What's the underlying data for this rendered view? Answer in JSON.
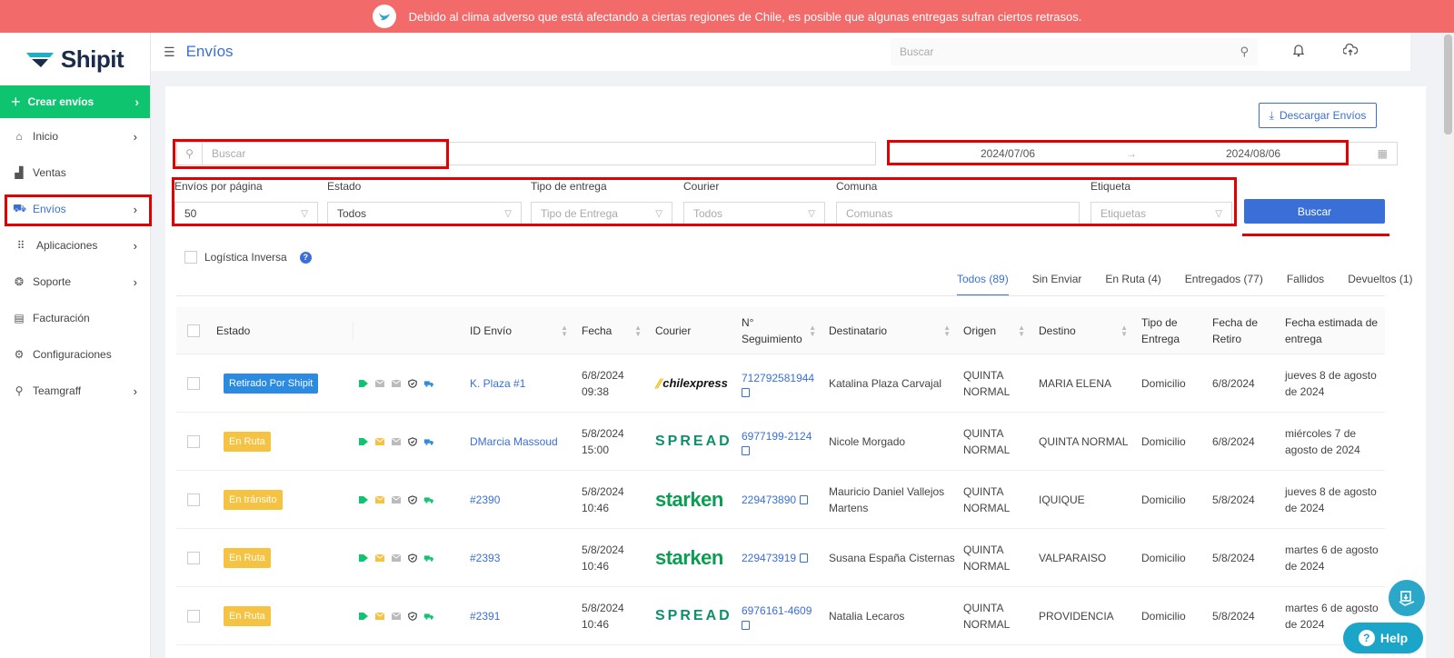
{
  "banner": {
    "text": "Debido al clima adverso que está afectando a ciertas regiones de Chile, es posible que algunas entregas sufran ciertos retrasos."
  },
  "sidebar": {
    "logo": "Shipit",
    "create_label": "Crear envíos",
    "items": [
      {
        "label": "Inicio",
        "icon": "home-icon",
        "chevron": true
      },
      {
        "label": "Ventas",
        "icon": "sales-icon",
        "chevron": false
      },
      {
        "label": "Envíos",
        "icon": "truck-icon",
        "chevron": true,
        "active": true
      },
      {
        "label": "Aplicaciones",
        "icon": "grid-icon",
        "chevron": true
      },
      {
        "label": "Soporte",
        "icon": "support-icon",
        "chevron": true
      },
      {
        "label": "Facturación",
        "icon": "invoice-icon",
        "chevron": false
      },
      {
        "label": "Configuraciones",
        "icon": "gear-icon",
        "chevron": false
      },
      {
        "label": "Teamgraff",
        "icon": "user-icon",
        "chevron": true
      }
    ]
  },
  "header": {
    "title": "Envíos",
    "search_placeholder": "Buscar"
  },
  "toolbar": {
    "download_label": "Descargar Envíos",
    "search_placeholder": "Buscar",
    "date_from": "2024/07/06",
    "date_to": "2024/08/06",
    "date_arrow": "→"
  },
  "filters": {
    "per_page": {
      "label": "Envíos por página",
      "value": "50"
    },
    "estado": {
      "label": "Estado",
      "value": "Todos"
    },
    "tipo_entrega": {
      "label": "Tipo de entrega",
      "placeholder": "Tipo de Entrega"
    },
    "courier": {
      "label": "Courier",
      "placeholder": "Todos"
    },
    "comuna": {
      "label": "Comuna",
      "placeholder": "Comunas"
    },
    "etiqueta": {
      "label": "Etiqueta",
      "placeholder": "Etiquetas"
    },
    "search_button": "Buscar"
  },
  "logistica_label": "Logística Inversa",
  "tabs": [
    "Todos (89)",
    "Sin Enviar",
    "En Ruta (4)",
    "Entregados (77)",
    "Fallidos",
    "Devueltos (1)"
  ],
  "table": {
    "headers": {
      "estado": "Estado",
      "id": "ID Envío",
      "fecha": "Fecha",
      "courier": "Courier",
      "seguimiento": "N° Seguimiento",
      "destinatario": "Destinatario",
      "origen": "Origen",
      "destino": "Destino",
      "tipo": "Tipo de Entrega",
      "retiro": "Fecha de Retiro",
      "estimada": "Fecha estimada de entrega"
    },
    "rows": [
      {
        "estado": "Retirado Por Shipit",
        "estado_color": "#2a8be0",
        "id": "K. Plaza #1",
        "fecha": "6/8/2024 09:38",
        "courier": "chilexpress",
        "tracking": "712792581944",
        "copy_inline": false,
        "destinatario": "Katalina Plaza Carvajal",
        "origen": "QUINTA NORMAL",
        "destino": "MARIA ELENA",
        "tipo": "Domicilio",
        "retiro": "6/8/2024",
        "estimada": "jueves 8 de agosto de 2024",
        "mail_color": "#bbb",
        "truck_color": "#2a8be0"
      },
      {
        "estado": "En Ruta",
        "estado_color": "#f5c242",
        "id": "DMarcia Massoud",
        "fecha": "5/8/2024 15:00",
        "courier": "SPREAD",
        "tracking": "6977199-2124",
        "copy_inline": false,
        "destinatario": "Nicole Morgado",
        "origen": "QUINTA NORMAL",
        "destino": "QUINTA NORMAL",
        "tipo": "Domicilio",
        "retiro": "6/8/2024",
        "estimada": "miércoles 7 de agosto de 2024",
        "mail_color": "#f5c242",
        "truck_color": "#2a8be0"
      },
      {
        "estado": "En tránsito",
        "estado_color": "#f5c242",
        "id": "#2390",
        "fecha": "5/8/2024 10:46",
        "courier": "starken",
        "tracking": "229473890",
        "copy_inline": true,
        "destinatario": "Mauricio Daniel Vallejos Martens",
        "origen": "QUINTA NORMAL",
        "destino": "IQUIQUE",
        "tipo": "Domicilio",
        "retiro": "5/8/2024",
        "estimada": "jueves 8 de agosto de 2024",
        "mail_color": "#f5c242",
        "truck_color": "#0ec46f"
      },
      {
        "estado": "En Ruta",
        "estado_color": "#f5c242",
        "id": "#2393",
        "fecha": "5/8/2024 10:46",
        "courier": "starken",
        "tracking": "229473919",
        "copy_inline": true,
        "destinatario": "Susana España Cisternas",
        "origen": "QUINTA NORMAL",
        "destino": "VALPARAISO",
        "tipo": "Domicilio",
        "retiro": "5/8/2024",
        "estimada": "martes 6 de agosto de 2024",
        "mail_color": "#f5c242",
        "truck_color": "#0ec46f"
      },
      {
        "estado": "En Ruta",
        "estado_color": "#f5c242",
        "id": "#2391",
        "fecha": "5/8/2024 10:46",
        "courier": "SPREAD",
        "tracking": "6976161-4609",
        "copy_inline": false,
        "destinatario": "Natalia Lecaros",
        "origen": "QUINTA NORMAL",
        "destino": "PROVIDENCIA",
        "tipo": "Domicilio",
        "retiro": "5/8/2024",
        "estimada": "martes 6 de agosto de 2024",
        "mail_color": "#f5c242",
        "truck_color": "#0ec46f"
      }
    ]
  },
  "help_label": "Help",
  "colors": {
    "primary": "#3a6fd8",
    "green": "#0ec46f",
    "banner": "#f26a6a",
    "highlight": "#e20000"
  }
}
